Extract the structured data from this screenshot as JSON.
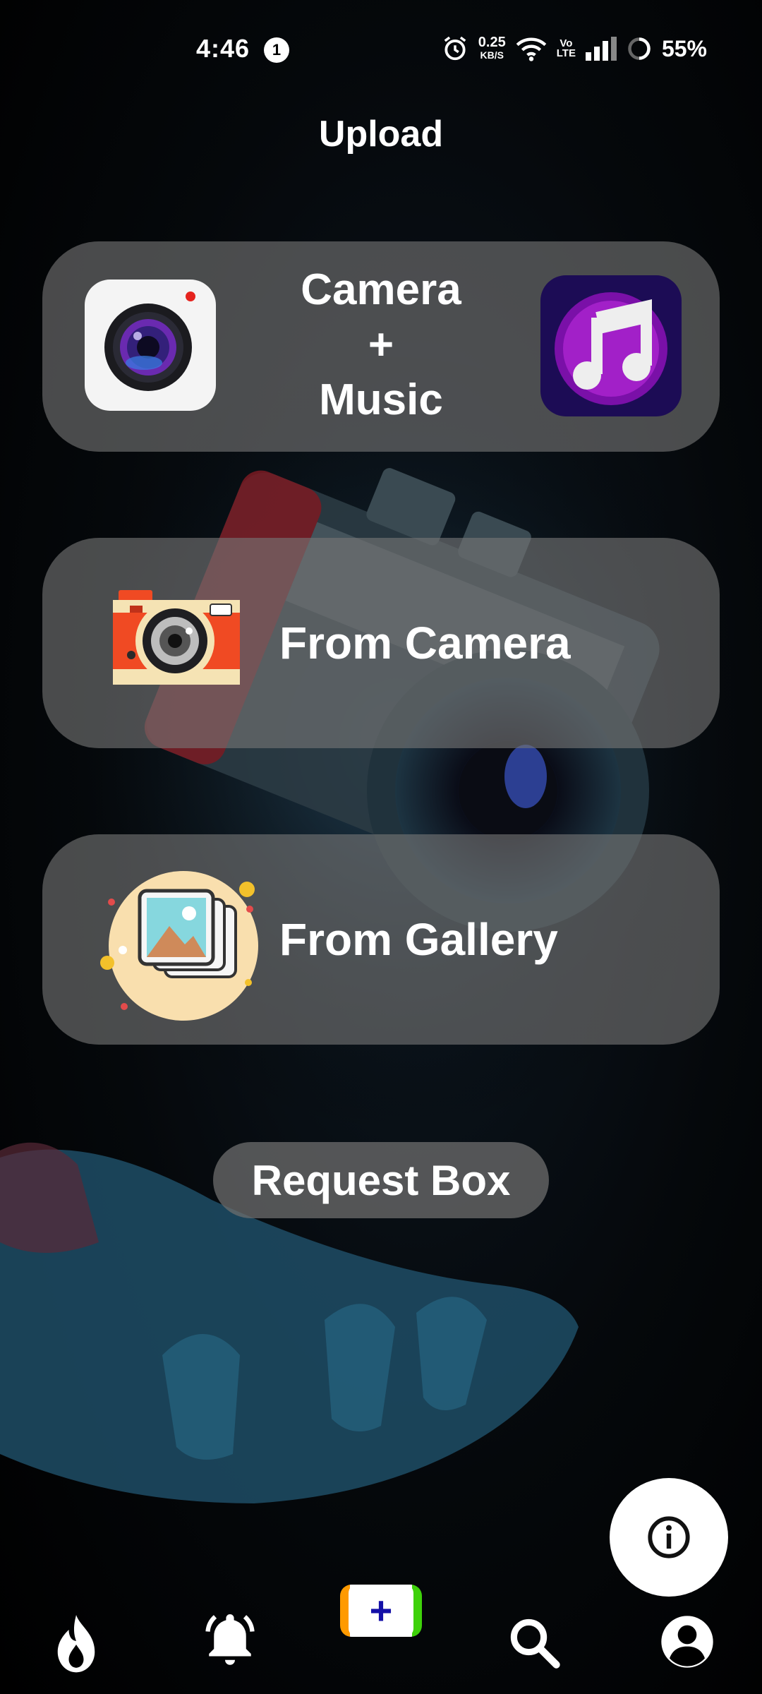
{
  "status_bar": {
    "time": "4:46",
    "notification_count": "1",
    "net_speed": "0.25",
    "net_speed_unit": "KB/S",
    "volte_top": "Vo",
    "volte_bottom": "LTE",
    "battery_percent": "55%"
  },
  "header": {
    "title": "Upload"
  },
  "options": {
    "camera_music": {
      "line1": "Camera",
      "line2": "+",
      "line3": "Music"
    },
    "from_camera": {
      "label": "From Camera"
    },
    "from_gallery": {
      "label": "From Gallery"
    }
  },
  "request_box": {
    "label": "Request Box"
  },
  "fab": {
    "icon": "info-icon"
  },
  "bottom_nav": {
    "items": [
      {
        "icon": "flame-icon"
      },
      {
        "icon": "bell-icon"
      },
      {
        "icon": "plus-icon",
        "label": "+"
      },
      {
        "icon": "search-icon"
      },
      {
        "icon": "account-icon"
      }
    ]
  },
  "colors": {
    "card_bg": "#767676",
    "add_left": "#ff9a00",
    "add_right": "#3ed10a",
    "add_plus": "#1410a8",
    "music_icon_bg": "#1c0c55",
    "music_icon_accent": "#a220c8"
  }
}
